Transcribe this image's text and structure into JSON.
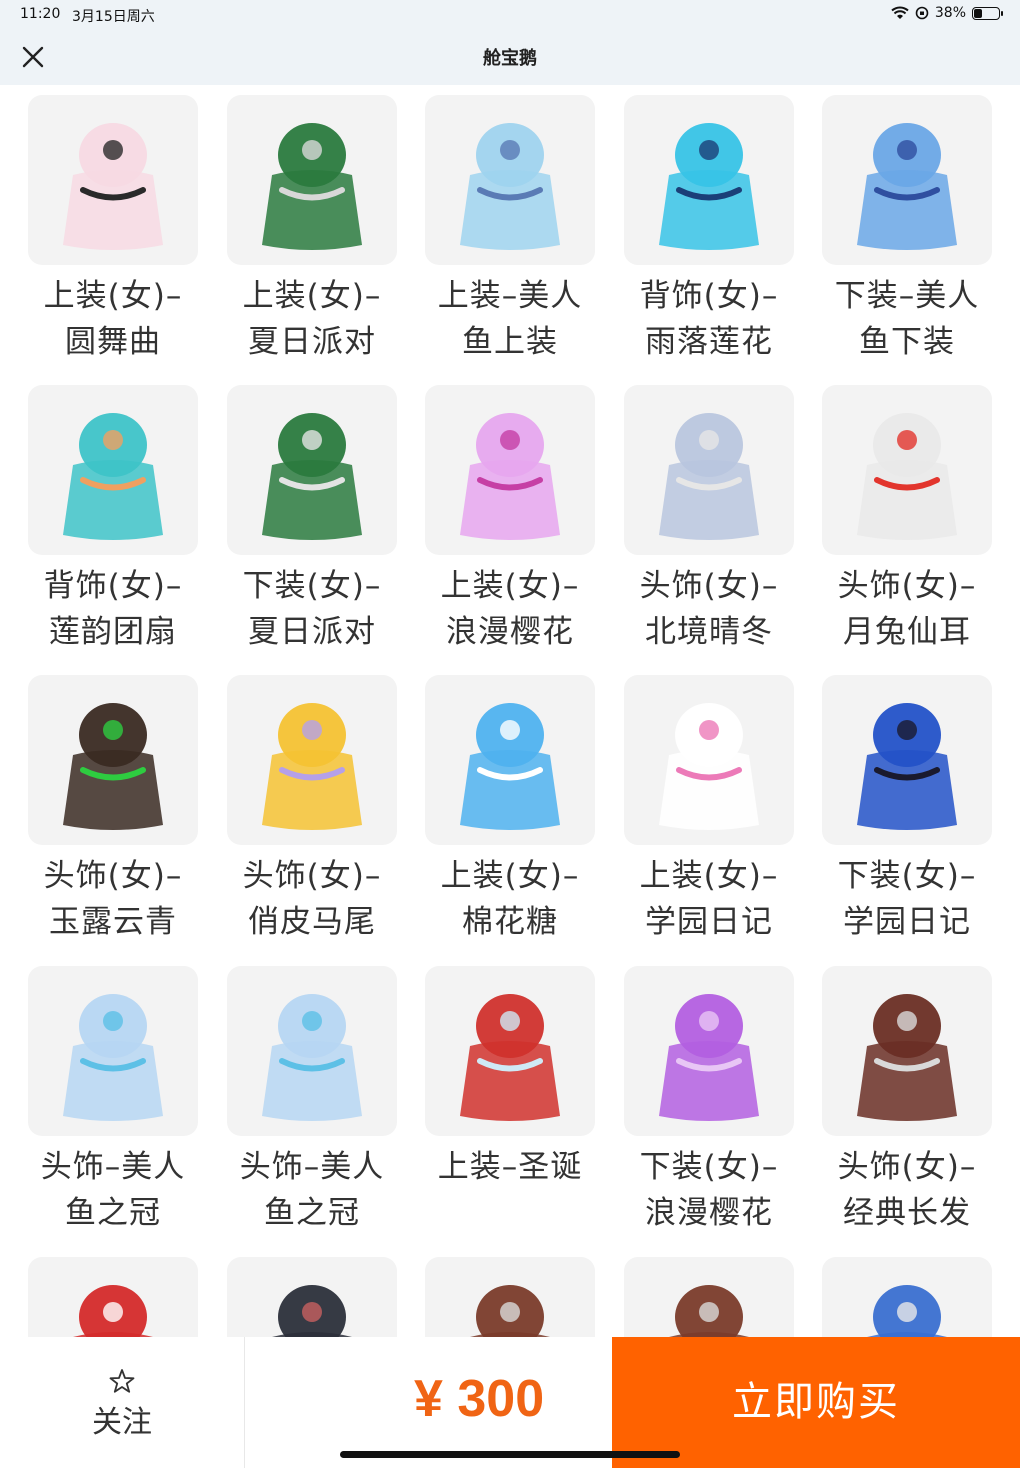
{
  "status_bar": {
    "time": "11:20",
    "date": "3月15日周六",
    "battery": "38%",
    "battery_level": 0.38
  },
  "nav": {
    "title": "舱宝鹅",
    "close_icon": "close-icon"
  },
  "items": [
    {
      "label": "上装(女)–\n圆舞曲",
      "color": "#f7d9e3",
      "accent": "#2a2a2a"
    },
    {
      "label": "上装(女)–\n夏日派对",
      "color": "#2a7a3e",
      "accent": "#d8d8d8"
    },
    {
      "label": "上装–美人\n鱼上装",
      "color": "#9fd3ee",
      "accent": "#5a7bb5"
    },
    {
      "label": "背饰(女)–\n雨落莲花",
      "color": "#37c3e6",
      "accent": "#1b3f78"
    },
    {
      "label": "下装–美人\n鱼下装",
      "color": "#6aa7e6",
      "accent": "#2f4fa0"
    },
    {
      "label": "背饰(女)–\n莲韵团扇",
      "color": "#3ec3c8",
      "accent": "#f0a060"
    },
    {
      "label": "下装(女)–\n夏日派对",
      "color": "#2a7a3e",
      "accent": "#e3e3e3"
    },
    {
      "label": "上装(女)–\n浪漫樱花",
      "color": "#e6a6ee",
      "accent": "#c63fa5"
    },
    {
      "label": "头饰(女)–\n北境晴冬",
      "color": "#b9c6de",
      "accent": "#e6e6e6"
    },
    {
      "label": "头饰(女)–\n月兔仙耳",
      "color": "#e9e9e9",
      "accent": "#e2352d"
    },
    {
      "label": "头饰(女)–\n玉露云青",
      "color": "#3a2a22",
      "accent": "#2ecc40"
    },
    {
      "label": "头饰(女)–\n俏皮马尾",
      "color": "#f4c233",
      "accent": "#b5a0e8"
    },
    {
      "label": "上装(女)–\n棉花糖",
      "color": "#4fb2ef",
      "accent": "#ffffff"
    },
    {
      "label": "上装(女)–\n学园日记",
      "color": "#ffffff",
      "accent": "#ec7ab8"
    },
    {
      "label": "下装(女)–\n学园日记",
      "color": "#2352c8",
      "accent": "#1a1a2e"
    },
    {
      "label": "头饰–美人\n鱼之冠",
      "color": "#b6d6f2",
      "accent": "#5dc0e6"
    },
    {
      "label": "头饰–美人\n鱼之冠",
      "color": "#b6d6f2",
      "accent": "#5dc0e6"
    },
    {
      "label": "上装–圣诞",
      "color": "#d0312d",
      "accent": "#cfe9f5"
    },
    {
      "label": "下装(女)–\n浪漫樱花",
      "color": "#b35fe0",
      "accent": "#e8c6f5"
    },
    {
      "label": "头饰(女)–\n经典长发",
      "color": "#6a2e24",
      "accent": "#d9d9d9"
    },
    {
      "label": "",
      "color": "#d42a2a",
      "accent": "#ffffff"
    },
    {
      "label": "",
      "color": "#2b2f3a",
      "accent": "#c86060"
    },
    {
      "label": "",
      "color": "#7a3b2a",
      "accent": "#d9d9d9"
    },
    {
      "label": "",
      "color": "#7a3b2a",
      "accent": "#d9d9d9"
    },
    {
      "label": "",
      "color": "#3a6fd0",
      "accent": "#e9e9e9"
    }
  ],
  "bottom_bar": {
    "follow_label": "关注",
    "star_icon": "star-icon",
    "price": "¥ 300",
    "buy_label": "立即购买"
  }
}
